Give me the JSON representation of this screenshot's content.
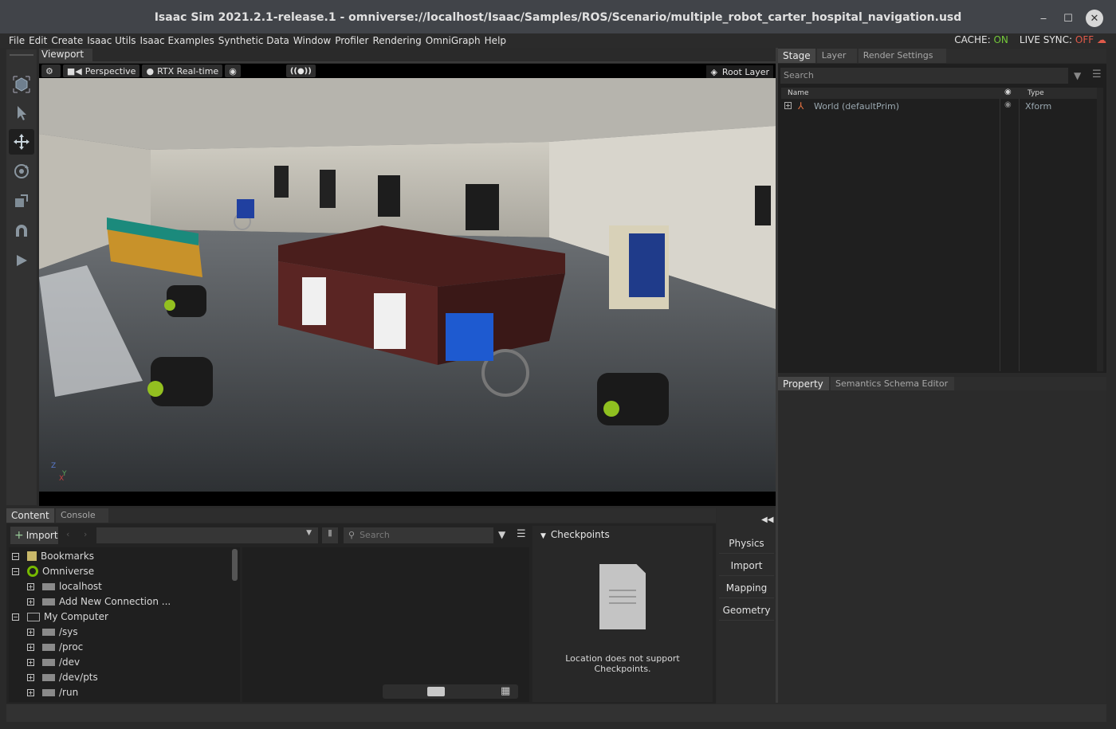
{
  "window": {
    "title": "Isaac Sim 2021.2.1-release.1 - omniverse://localhost/Isaac/Samples/ROS/Scenario/multiple_robot_carter_hospital_navigation.usd",
    "minimize": "‒",
    "maximize": "☐",
    "close": "✕"
  },
  "menu": {
    "items": [
      "File",
      "Edit",
      "Create",
      "Isaac Utils",
      "Isaac Examples",
      "Synthetic Data",
      "Window",
      "Profiler",
      "Rendering",
      "OmniGraph",
      "Help"
    ],
    "cache_label": "CACHE:",
    "cache_value": "ON",
    "livesync_label": "LIVE SYNC:",
    "livesync_value": "OFF"
  },
  "viewport": {
    "tab": "Viewport",
    "camera": "Perspective",
    "renderer": "RTX Real-time",
    "broadcast": "((●))",
    "root_layer": "Root Layer",
    "axis_z": "Z",
    "axis_y": "Y",
    "axis_x": "X"
  },
  "stage_panel": {
    "tabs": [
      "Stage",
      "Layer",
      "Render Settings"
    ],
    "search_placeholder": "Search",
    "col_name": "Name",
    "col_type": "Type",
    "rows": [
      {
        "name": "World (defaultPrim)",
        "type": "Xform"
      }
    ]
  },
  "property_panel": {
    "tabs": [
      "Property",
      "Semantics Schema Editor"
    ]
  },
  "content_panel": {
    "tabs": [
      "Content",
      "Console"
    ],
    "import_label": "Import",
    "search_placeholder": "Search",
    "tree": [
      {
        "label": "Bookmarks",
        "level": 0,
        "exp": "−"
      },
      {
        "label": "Omniverse",
        "level": 0,
        "exp": "−"
      },
      {
        "label": "localhost",
        "level": 1,
        "exp": "+"
      },
      {
        "label": "Add New Connection ...",
        "level": 1,
        "exp": "+"
      },
      {
        "label": "My Computer",
        "level": 0,
        "exp": "−"
      },
      {
        "label": "/sys",
        "level": 1,
        "exp": "+"
      },
      {
        "label": "/proc",
        "level": 1,
        "exp": "+"
      },
      {
        "label": "/dev",
        "level": 1,
        "exp": "+"
      },
      {
        "label": "/dev/pts",
        "level": 1,
        "exp": "+"
      },
      {
        "label": "/run",
        "level": 1,
        "exp": "+"
      }
    ],
    "checkpoints_title": "Checkpoints",
    "checkpoints_msg_1": "Location does not support",
    "checkpoints_msg_2": "Checkpoints."
  },
  "side_buttons": [
    "Physics",
    "Import",
    "Mapping",
    "Geometry"
  ],
  "colors": {
    "accent_on": "#74c93a",
    "accent_off": "#e05a4a",
    "bg": "#2a2a2a"
  }
}
